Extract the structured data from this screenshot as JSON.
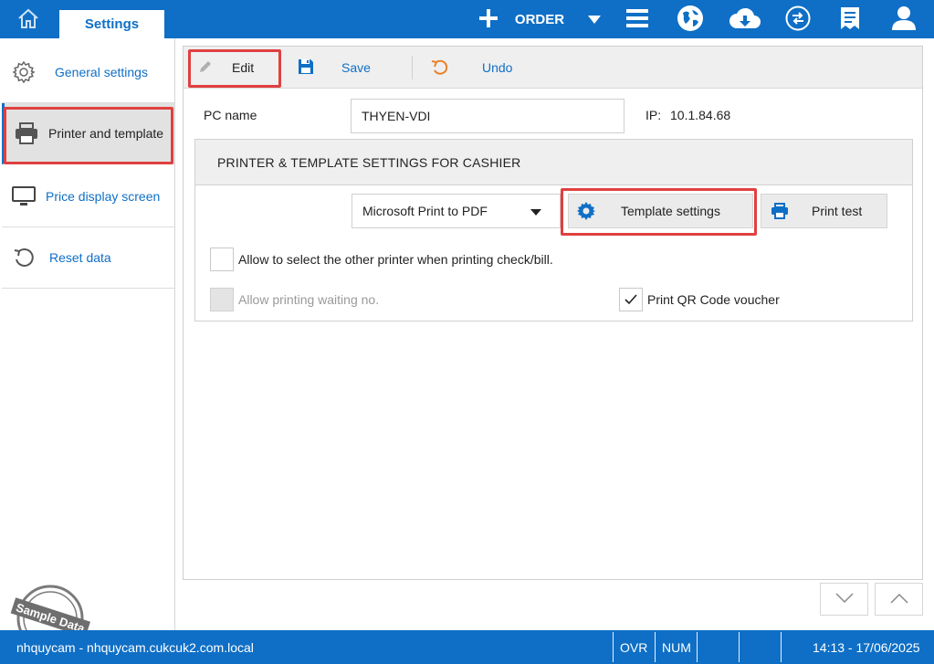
{
  "topbar": {
    "tab_settings": "Settings",
    "order_label": "ORDER"
  },
  "sidebar": {
    "items": [
      {
        "label": "General settings",
        "icon": "gear-icon"
      },
      {
        "label": "Printer and template",
        "icon": "printer-icon"
      },
      {
        "label": "Price display screen",
        "icon": "monitor-icon"
      },
      {
        "label": "Reset data",
        "icon": "reset-icon"
      }
    ],
    "active_index": 1
  },
  "toolbar": {
    "edit_label": "Edit",
    "save_label": "Save",
    "undo_label": "Undo"
  },
  "form": {
    "pc_name_label": "PC name",
    "pc_name_value": "THYEN-VDI",
    "ip_label": "IP:",
    "ip_value": "10.1.84.68"
  },
  "section": {
    "title": "PRINTER & TEMPLATE SETTINGS FOR CASHIER",
    "printer_selected": "Microsoft Print to PDF",
    "template_settings_label": "Template settings",
    "print_test_label": "Print test",
    "options": [
      {
        "label": "Allow to select the other printer when printing check/bill.",
        "checked": false,
        "enabled": true
      },
      {
        "label": "Allow printing waiting no.",
        "checked": false,
        "enabled": false
      },
      {
        "label": "Print QR Code voucher",
        "checked": true,
        "enabled": true
      }
    ]
  },
  "watermark": {
    "text": "Sample Data"
  },
  "statusbar": {
    "user": "nhquycam - nhquycam.cukcuk2.com.local",
    "ovr": "OVR",
    "num": "NUM",
    "datetime": "14:13 - 17/06/2025"
  },
  "colors": {
    "brand": "#0f6fc6",
    "highlight": "#e04040"
  }
}
